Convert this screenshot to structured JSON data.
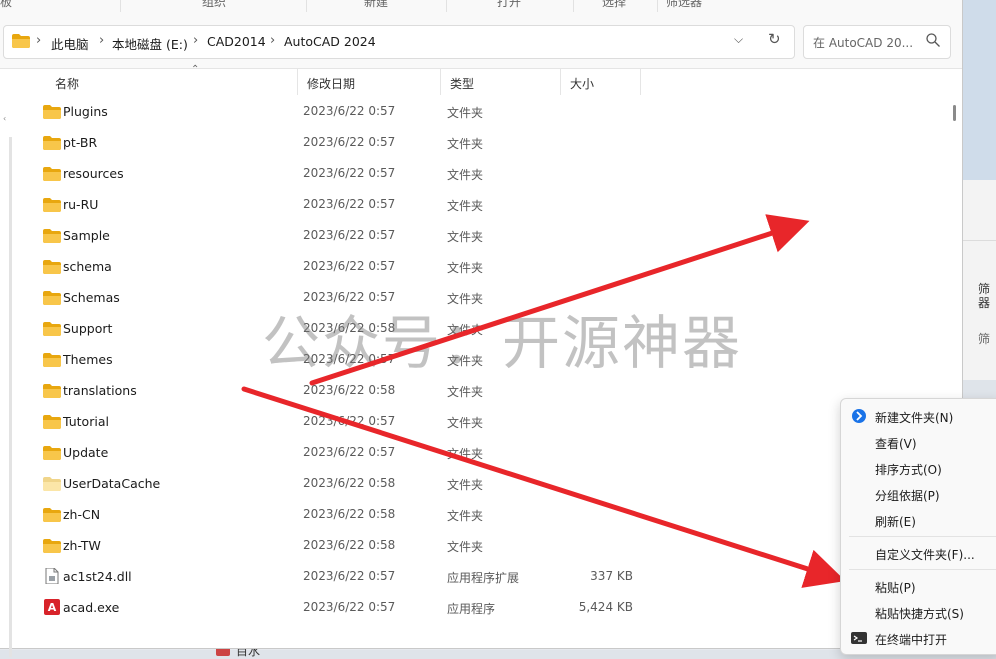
{
  "command_bar": {
    "left_partial": "板",
    "organize": "组织",
    "new": "新建",
    "open": "打开",
    "select": "选择",
    "filter": "筛选器"
  },
  "address": {
    "crumbs": [
      "此电脑",
      "本地磁盘 (E:)",
      "CAD2014",
      "AutoCAD 2024"
    ]
  },
  "search": {
    "placeholder": "在 AutoCAD 20..."
  },
  "columns": {
    "name": "名称",
    "date": "修改日期",
    "type": "类型",
    "size": "大小"
  },
  "files": [
    {
      "name": "Plugins",
      "date": "2023/6/22 0:57",
      "type": "文件夹",
      "size": "",
      "icon": "folder-icon"
    },
    {
      "name": "pt-BR",
      "date": "2023/6/22 0:57",
      "type": "文件夹",
      "size": "",
      "icon": "folder-icon"
    },
    {
      "name": "resources",
      "date": "2023/6/22 0:57",
      "type": "文件夹",
      "size": "",
      "icon": "folder-icon"
    },
    {
      "name": "ru-RU",
      "date": "2023/6/22 0:57",
      "type": "文件夹",
      "size": "",
      "icon": "folder-icon"
    },
    {
      "name": "Sample",
      "date": "2023/6/22 0:57",
      "type": "文件夹",
      "size": "",
      "icon": "folder-icon"
    },
    {
      "name": "schema",
      "date": "2023/6/22 0:57",
      "type": "文件夹",
      "size": "",
      "icon": "folder-icon"
    },
    {
      "name": "Schemas",
      "date": "2023/6/22 0:57",
      "type": "文件夹",
      "size": "",
      "icon": "folder-icon"
    },
    {
      "name": "Support",
      "date": "2023/6/22 0:58",
      "type": "文件夹",
      "size": "",
      "icon": "folder-icon"
    },
    {
      "name": "Themes",
      "date": "2023/6/22 0:57",
      "type": "文件夹",
      "size": "",
      "icon": "folder-icon"
    },
    {
      "name": "translations",
      "date": "2023/6/22 0:58",
      "type": "文件夹",
      "size": "",
      "icon": "folder-icon"
    },
    {
      "name": "Tutorial",
      "date": "2023/6/22 0:57",
      "type": "文件夹",
      "size": "",
      "icon": "folder-icon"
    },
    {
      "name": "Update",
      "date": "2023/6/22 0:57",
      "type": "文件夹",
      "size": "",
      "icon": "folder-icon"
    },
    {
      "name": "UserDataCache",
      "date": "2023/6/22 0:58",
      "type": "文件夹",
      "size": "",
      "icon": "folder-light-icon"
    },
    {
      "name": "zh-CN",
      "date": "2023/6/22 0:58",
      "type": "文件夹",
      "size": "",
      "icon": "folder-icon"
    },
    {
      "name": "zh-TW",
      "date": "2023/6/22 0:58",
      "type": "文件夹",
      "size": "",
      "icon": "folder-icon"
    },
    {
      "name": "ac1st24.dll",
      "date": "2023/6/22 0:57",
      "type": "应用程序扩展",
      "size": "337 KB",
      "icon": "dll-file-icon"
    },
    {
      "name": "acad.exe",
      "date": "2023/6/22 0:57",
      "type": "应用程序",
      "size": "5,424 KB",
      "icon": "autocad-app-icon"
    }
  ],
  "watermark": "公众号：开源神器",
  "context_menu": {
    "new_folder": "新建文件夹(N)",
    "view": "查看(V)",
    "sort": "排序方式(O)",
    "group": "分组依据(P)",
    "refresh": "刷新(E)",
    "customize": "自定义文件夹(F)...",
    "paste": "粘贴(P)",
    "paste_shortcut": "粘贴快捷方式(S)",
    "open_terminal": "在终端中打开"
  },
  "background_window": {
    "text1": "筛器",
    "text2": "筛"
  },
  "taskbar": {
    "partial": "目水"
  },
  "colors": {
    "folder": "#f8c64a",
    "arrow": "#e8262a",
    "autocad": "#d8232a",
    "accent": "#0067c0"
  }
}
